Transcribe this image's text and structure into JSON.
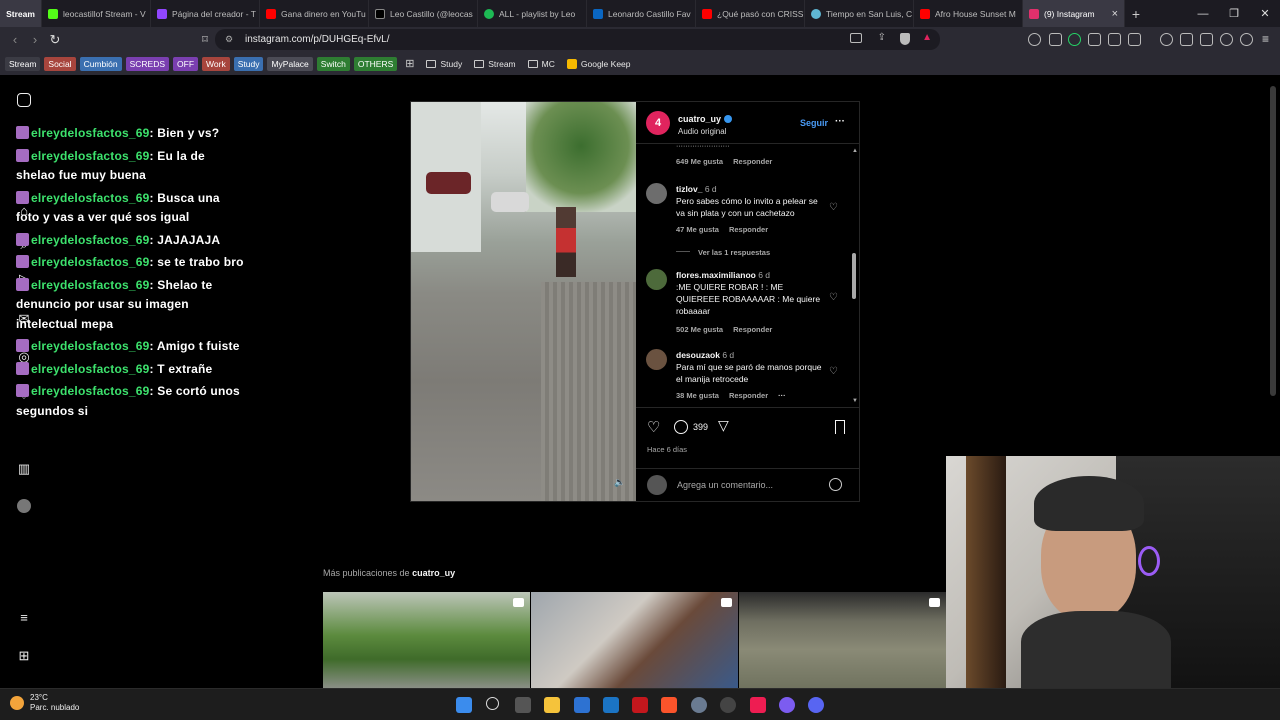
{
  "browser": {
    "tabs": [
      {
        "label": "Stream",
        "color": "#3a3944"
      },
      {
        "label": "leocastillof Stream - V",
        "color": "#53fc18"
      },
      {
        "label": "Página del creador - T",
        "color": "#9146ff"
      },
      {
        "label": "Gana dinero en YouTu",
        "color": "#ff0000"
      },
      {
        "label": "Leo Castillo (@leocas",
        "color": "#000000"
      },
      {
        "label": "ALL - playlist by Leo",
        "color": "#1db954"
      },
      {
        "label": "Leonardo Castillo Fav",
        "color": "#0a66c2"
      },
      {
        "label": "¿Qué pasó con CRISS",
        "color": "#ff0000"
      },
      {
        "label": "Tiempo en San Luis, C",
        "color": "#5fb7d4"
      },
      {
        "label": "Afro House Sunset M",
        "color": "#ff0000"
      },
      {
        "label": "(9) Instagram",
        "color": "#e1306c",
        "active": true
      }
    ],
    "new_tab": "+",
    "url": "instagram.com/p/DUHGEq-EfvL/",
    "bookmark_tags": [
      {
        "label": "Stream",
        "color": "#3b3b44"
      },
      {
        "label": "Social",
        "color": "#c0504d"
      },
      {
        "label": "Cumbión",
        "color": "#3a6fb0"
      },
      {
        "label": "SCREDS",
        "color": "#7a3fb0"
      },
      {
        "label": "OFF",
        "color": "#7a3fb0"
      },
      {
        "label": "Work",
        "color": "#c0504d"
      },
      {
        "label": "Study",
        "color": "#3a6fb0"
      },
      {
        "label": "MyPalace",
        "color": "#4b4b55"
      },
      {
        "label": "Switch",
        "color": "#2e7d32"
      },
      {
        "label": "OTHERS",
        "color": "#2e7d32"
      }
    ],
    "bookmark_folders": [
      "Study",
      "Stream",
      "MC"
    ],
    "bookmark_link": "Google Keep"
  },
  "chat": {
    "messages": [
      {
        "user": "elreydelosfactos_69",
        "text": ": Bien y vs?"
      },
      {
        "user": "elreydelosfactos_69",
        "text": ": Eu la de shelao fue muy buena"
      },
      {
        "user": "elreydelosfactos_69",
        "text": ": Busca una foto y vas a ver qué sos igual"
      },
      {
        "user": "elreydelosfactos_69",
        "text": ": JAJAJAJA"
      },
      {
        "user": "elreydelosfactos_69",
        "text": ": se te trabo bro"
      },
      {
        "user": "elreydelosfactos_69",
        "text": ": Shelao te denuncio por usar su imagen intelectual mepa"
      },
      {
        "user": "elreydelosfactos_69",
        "text": ": Amigo t fuiste"
      },
      {
        "user": "elreydelosfactos_69",
        "text": ": T extrañe"
      },
      {
        "user": "elreydelosfactos_69",
        "text": ": Se cortó unos segundos si"
      }
    ]
  },
  "post": {
    "author": "cuatro_uy",
    "audio": "Audio original",
    "follow": "Seguir",
    "more": "···",
    "comments": [
      {
        "user": "",
        "time": "",
        "text": "",
        "likes": "649 Me gusta",
        "reply": "Responder"
      },
      {
        "user": "tizlov_",
        "time": "6 d",
        "text": "Pero sabes cómo lo invito a pelear se va sin plata y con un cachetazo",
        "likes": "47 Me gusta",
        "reply": "Responder"
      },
      {
        "user": "flores.maximilianoo",
        "time": "6 d",
        "text": ":ME QUIERE ROBAR ! : ME QUIEREEE ROBAAAAAR : Me quiere robaaaar",
        "likes": "502 Me gusta",
        "reply": "Responder"
      },
      {
        "user": "desouzaok",
        "time": "6 d",
        "text": "Para mí que se paró de manos porque el manija retrocede",
        "likes": "38 Me gusta",
        "reply": "Responder"
      }
    ],
    "view_replies": "Ver las 1 respuestas",
    "comment_count": "399",
    "posted": "Hace 6 días",
    "add_comment_placeholder": "Agrega un comentario..."
  },
  "more_posts": {
    "prefix": "Más publicaciones de",
    "author": "cuatro_uy"
  },
  "taskbar": {
    "temp": "23°C",
    "condition": "Parc. nublado"
  }
}
